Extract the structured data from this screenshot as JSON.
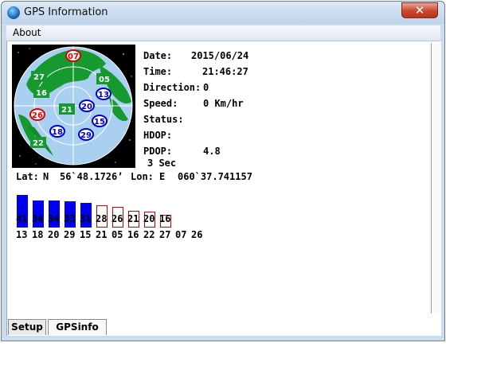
{
  "window": {
    "title": "GPS Information",
    "close_glyph": "✕"
  },
  "menu": {
    "about": "About"
  },
  "info": {
    "date_label": "Date:",
    "date_value": "2015/06/24",
    "time_label": "Time:",
    "time_value": "21:46:27",
    "direction_label": "Direction:",
    "direction_value": "0",
    "speed_label": "Speed:",
    "speed_value": "0 Km/hr",
    "status_label": "Status:",
    "status_value": "",
    "hdop_label": "HDOP:",
    "hdop_value": "",
    "pdop_label": "PDOP:",
    "pdop_value": "4.8",
    "interval": "3 Sec"
  },
  "position": {
    "lat_label": "Lat:",
    "lat_hemi": "N",
    "lat_value": "56`48.1726’",
    "lon_label": "Lon:",
    "lon_hemi": "E",
    "lon_value": "060`37.741157"
  },
  "satellites_sky": [
    {
      "prn": "07",
      "style": "red"
    },
    {
      "prn": "27",
      "style": "green"
    },
    {
      "prn": "05",
      "style": "green"
    },
    {
      "prn": "16",
      "style": "green"
    },
    {
      "prn": "13",
      "style": "blue"
    },
    {
      "prn": "21",
      "style": "green"
    },
    {
      "prn": "20",
      "style": "blue"
    },
    {
      "prn": "26",
      "style": "red"
    },
    {
      "prn": "15",
      "style": "blue"
    },
    {
      "prn": "18",
      "style": "blue"
    },
    {
      "prn": "29",
      "style": "blue"
    },
    {
      "prn": "22",
      "style": "green"
    }
  ],
  "snr_bars": [
    {
      "snr": "41",
      "prn": "13",
      "used": true
    },
    {
      "snr": "34",
      "prn": "18",
      "used": true
    },
    {
      "snr": "34",
      "prn": "20",
      "used": true
    },
    {
      "snr": "33",
      "prn": "29",
      "used": true
    },
    {
      "snr": "31",
      "prn": "15",
      "used": true
    },
    {
      "snr": "28",
      "prn": "21",
      "used": false
    },
    {
      "snr": "26",
      "prn": "05",
      "used": false
    },
    {
      "snr": "21",
      "prn": "16",
      "used": false
    },
    {
      "snr": "20",
      "prn": "22",
      "used": false
    },
    {
      "snr": "16",
      "prn": "27",
      "used": false
    },
    {
      "snr": "",
      "prn": "07",
      "used": false
    },
    {
      "snr": "",
      "prn": "26",
      "used": false
    }
  ],
  "tabs": {
    "setup": "Setup",
    "gpsinfo": "GPSinfo"
  },
  "colors": {
    "used_bar": "#0000ee",
    "unused_bar": "#cc0000",
    "ocean": "#a9d0f0",
    "land": "#169a2f"
  }
}
